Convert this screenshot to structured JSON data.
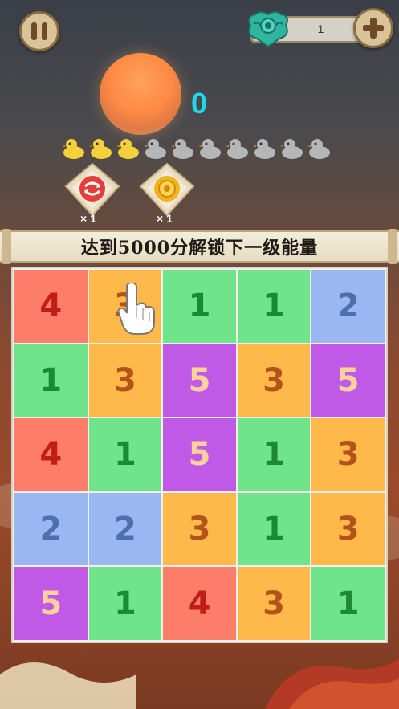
{
  "hud": {
    "currency_count": "1",
    "score": "0"
  },
  "progress": {
    "ducks_total": 10,
    "ducks_filled": 3,
    "filled_color": "#f4d03a",
    "empty_color": "#b4b6b8"
  },
  "powerups": [
    {
      "icon": "shuffle-icon",
      "count": "× 1",
      "color": "#e43f3a"
    },
    {
      "icon": "flower-icon",
      "count": "× 1",
      "color": "#f1b51a"
    }
  ],
  "banner": {
    "text": "达到5000分解锁下一级能量"
  },
  "tile_colors": {
    "1": {
      "bg": "#6fe48a",
      "fg": "#1c8a32"
    },
    "2": {
      "bg": "#9bb7f2",
      "fg": "#4d6fae"
    },
    "3": {
      "bg": "#ffb94a",
      "fg": "#b4521a"
    },
    "4": {
      "bg": "#fb7d6a",
      "fg": "#c01e12"
    },
    "5": {
      "bg": "#c05ae6",
      "fg": "#f8d29a"
    }
  },
  "board": [
    [
      "4",
      "3",
      "1",
      "1",
      "2"
    ],
    [
      "1",
      "3",
      "5",
      "3",
      "5"
    ],
    [
      "4",
      "1",
      "5",
      "1",
      "3"
    ],
    [
      "2",
      "2",
      "3",
      "1",
      "3"
    ],
    [
      "5",
      "1",
      "4",
      "3",
      "1"
    ]
  ]
}
